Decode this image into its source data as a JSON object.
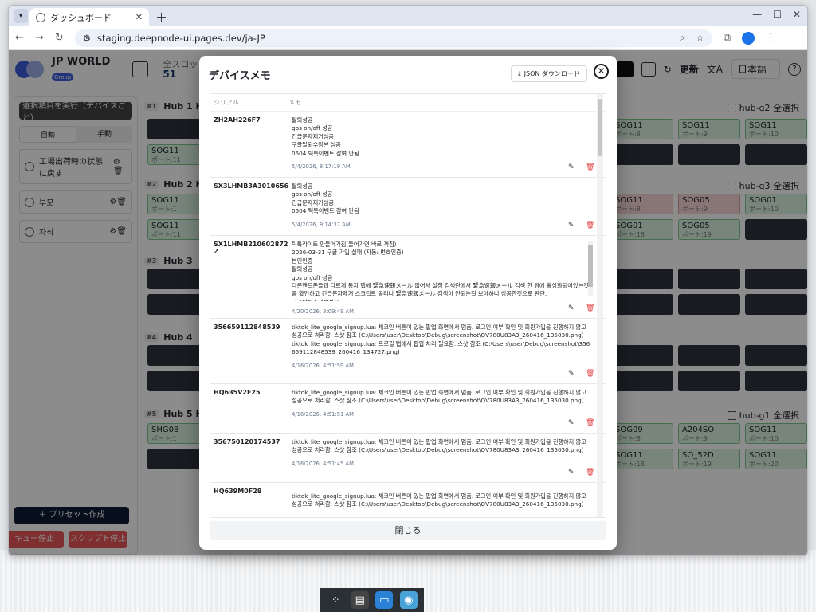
{
  "browser": {
    "tab_title": "ダッシュボード",
    "url": "staging.deepnode-ui.pages.dev/ja-JP"
  },
  "header": {
    "brand": "JP WORLD",
    "brand_badge": "Group",
    "slots_label": "全スロット",
    "slots_count": "51",
    "update_label": "更新",
    "language": "日本語",
    "help": "?"
  },
  "sidebar": {
    "run_button": "選択項目を実行（デバイスごと）",
    "mode_auto": "自動",
    "mode_manual": "手動",
    "presets": [
      "工場出荷時の状態に戻す",
      "부모",
      "자식"
    ],
    "create_preset": "＋ プリセット作成",
    "queue_stop": "キュー停止",
    "script_stop": "スクリプト停止"
  },
  "hubs": [
    {
      "num": "#1",
      "name": "Hub 1 H",
      "select": "hub-g2 全選択"
    },
    {
      "num": "#2",
      "name": "Hub 2 H",
      "select": "hub-g3 全選択"
    },
    {
      "num": "#3",
      "name": "Hub 3",
      "select": ""
    },
    {
      "num": "#4",
      "name": "Hub 4",
      "select": ""
    },
    {
      "num": "#5",
      "name": "Hub 5 H",
      "select": "hub-g1 全選択"
    }
  ],
  "slots": {
    "sog11": "SOG11",
    "sog05": "SOG05",
    "sog01": "SOG01",
    "shg08": "SHG08",
    "sog09": "SOG09",
    "a204so": "A204SO",
    "so52d": "SO_52D",
    "p1": "ポート:1",
    "p8": "ポート:8",
    "p9": "ポート:9",
    "p10": "ポート:10",
    "p11": "ポート:11",
    "p18": "ポート:18",
    "p19": "ポート:19",
    "p20": "ポート:20"
  },
  "modal": {
    "title": "デバイスメモ",
    "json_button": "JSON ダウンロード",
    "col_serial": "シリアル",
    "col_memo": "メモ",
    "close_button": "閉じる",
    "rows": [
      {
        "serial": "ZH2AH226F7",
        "memo": "탈퇴성공\ngps on/off 성공\n긴급문자제거성공\n구글탈퇴수정본 성공\n 0504 틱톡이벤트 참여 안됨",
        "time": "5/4/2026, 8:17:19 AM"
      },
      {
        "serial": "SX3LHMB3A3010656",
        "memo": "탈퇴성공\ngps on/off 성공\n긴급문자제거성공\n0504 틱톡이벤트 참여 안됨",
        "time": "5/4/2026, 8:14:37 AM"
      },
      {
        "serial": "SX1LHMB210602872",
        "memo": "틱톡라이트 안들어가짐(들어가면 바로 꺼짐)\n2026-03-31 구글 가입 실패 (자동: 번호인증)\n본인인증\n탈퇴성공\ngps on/off 성공\n다른핸드폰들과 다르게 통지 탭에 緊急速報メール 없어서 설정 검색란에서 緊急速報メール 검색 한 뒤에 활성화되어있는것을 확인하고 긴급문자제거 스크립트 돌리니 緊急速報メール 검색이 안되는걸 보아하니 성공한것으로 판단.\n구글탈퇴수정본성공",
        "time": "4/20/2026, 3:09:49 AM"
      },
      {
        "serial": "356659112848539",
        "memo": "tiktok_lite_google_signup.lua: 체크인 버튼이 있는 팝업 화면에서 멈춤. 로그인 여부 확인 및 회원가입을 진행하지 않고 성공으로 처리함. 스샷 참조 (C:\\Users\\user\\Desktop\\Debug\\screenshot\\QV780U83A3_260416_135030.png)\ntiktok_lite_google_signup.lua: 프로필 탭에서 팝업 처리 필요함. 스샷 참조 (C:\\Users\\user\\Debug\\screenshot\\356659112848539_260416_134727.png)",
        "time": "4/16/2026, 4:51:59 AM"
      },
      {
        "serial": "HQ635V2F25",
        "memo": "tiktok_lite_google_signup.lua: 체크인 버튼이 있는 팝업 화면에서 멈춤. 로그인 여부 확인 및 회원가입을 진행하지 않고 성공으로 처리함. 스샷 참조 (C:\\Users\\user\\Desktop\\Debug\\screenshot\\QV780U83A3_260416_135030.png)",
        "time": "4/16/2026, 4:51:51 AM"
      },
      {
        "serial": "356750120174537",
        "memo": "tiktok_lite_google_signup.lua: 체크인 버튼이 있는 팝업 화면에서 멈춤. 로그인 여부 확인 및 회원가입을 진행하지 않고 성공으로 처리함. 스샷 참조 (C:\\Users\\user\\Desktop\\Debug\\screenshot\\QV780U83A3_260416_135030.png)",
        "time": "4/16/2026, 4:51:45 AM"
      },
      {
        "serial": "HQ639M0F28",
        "memo": "tiktok_lite_google_signup.lua: 체크인 버튼이 있는 팝업 화면에서 멈춤. 로그인 여부 확인 및 회원가입을 진행하지 않고 성공으로 처리함. 스샷 참조 (C:\\Users\\user\\Desktop\\Debug\\screenshot\\QV780U83A3_260416_135030.png)",
        "time": ""
      }
    ]
  }
}
